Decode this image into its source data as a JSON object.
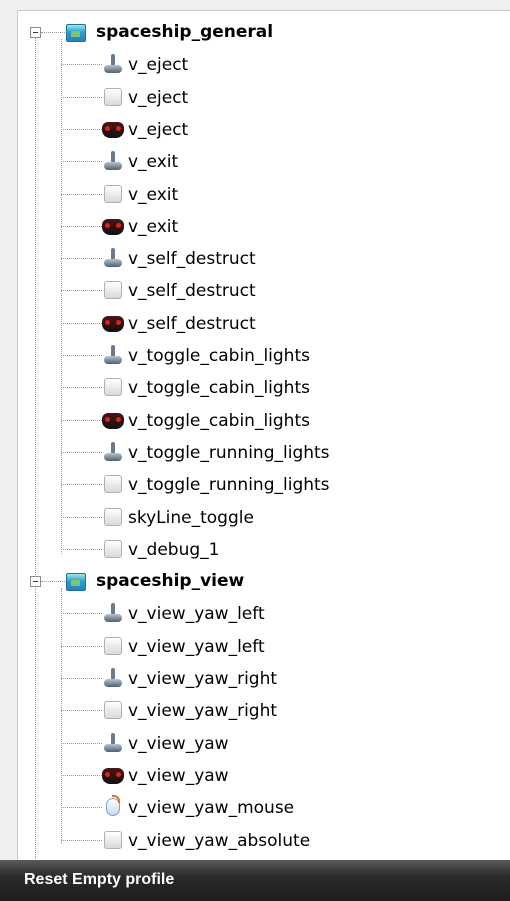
{
  "tree": {
    "groups": [
      {
        "label": "spaceship_general",
        "items": [
          {
            "label": "v_eject",
            "icon": "joystick-icon"
          },
          {
            "label": "v_eject",
            "icon": "keyboard-key-icon"
          },
          {
            "label": "v_eject",
            "icon": "gamepad-icon"
          },
          {
            "label": "v_exit",
            "icon": "joystick-icon"
          },
          {
            "label": "v_exit",
            "icon": "keyboard-key-icon"
          },
          {
            "label": "v_exit",
            "icon": "gamepad-icon"
          },
          {
            "label": "v_self_destruct",
            "icon": "joystick-icon"
          },
          {
            "label": "v_self_destruct",
            "icon": "keyboard-key-icon"
          },
          {
            "label": "v_self_destruct",
            "icon": "gamepad-icon"
          },
          {
            "label": "v_toggle_cabin_lights",
            "icon": "joystick-icon"
          },
          {
            "label": "v_toggle_cabin_lights",
            "icon": "keyboard-key-icon"
          },
          {
            "label": "v_toggle_cabin_lights",
            "icon": "gamepad-icon"
          },
          {
            "label": "v_toggle_running_lights",
            "icon": "joystick-icon"
          },
          {
            "label": "v_toggle_running_lights",
            "icon": "keyboard-key-icon"
          },
          {
            "label": "skyLine_toggle",
            "icon": "keyboard-key-icon"
          },
          {
            "label": "v_debug_1",
            "icon": "keyboard-key-icon"
          }
        ]
      },
      {
        "label": "spaceship_view",
        "items": [
          {
            "label": "v_view_yaw_left",
            "icon": "joystick-icon"
          },
          {
            "label": "v_view_yaw_left",
            "icon": "keyboard-key-icon"
          },
          {
            "label": "v_view_yaw_right",
            "icon": "joystick-icon"
          },
          {
            "label": "v_view_yaw_right",
            "icon": "keyboard-key-icon"
          },
          {
            "label": "v_view_yaw",
            "icon": "joystick-icon"
          },
          {
            "label": "v_view_yaw",
            "icon": "gamepad-icon"
          },
          {
            "label": "v_view_yaw_mouse",
            "icon": "mouse-icon"
          },
          {
            "label": "v_view_yaw_absolute",
            "icon": "keyboard-key-icon"
          }
        ]
      }
    ]
  },
  "statusbar": {
    "text": "Reset Empty profile"
  }
}
